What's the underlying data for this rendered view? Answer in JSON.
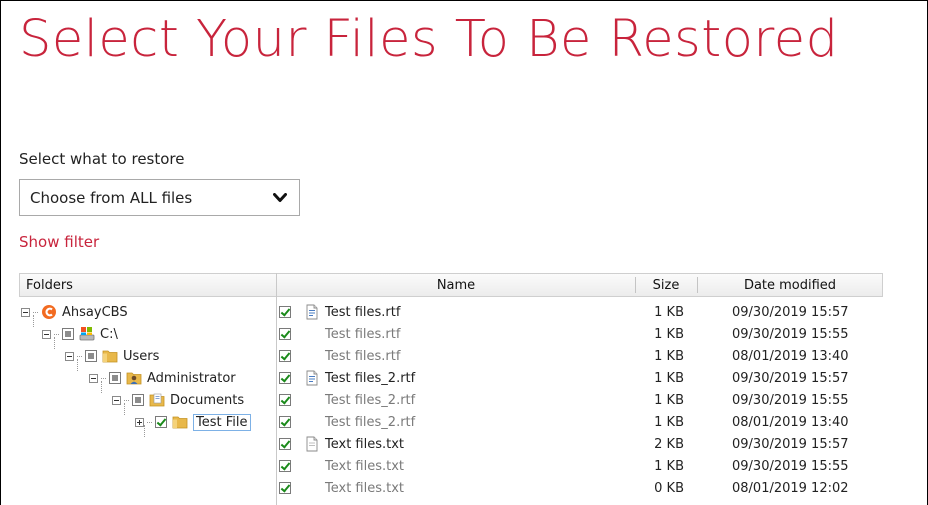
{
  "title": "Select Your Files To Be Restored",
  "restore_select": {
    "label": "Select what to restore",
    "value": "Choose from ALL files"
  },
  "show_filter": "Show filter",
  "folders": {
    "header": "Folders",
    "tree": [
      {
        "label": "AhsayCBS",
        "icon": "ahsay-logo-icon",
        "check": "none"
      },
      {
        "label": "C:\\",
        "icon": "drive-icon",
        "check": "partial"
      },
      {
        "label": "Users",
        "icon": "folder-icon",
        "check": "partial"
      },
      {
        "label": "Administrator",
        "icon": "user-folder-icon",
        "check": "partial"
      },
      {
        "label": "Documents",
        "icon": "documents-folder-icon",
        "check": "partial"
      },
      {
        "label": "Test File",
        "icon": "folder-icon",
        "check": "checked"
      }
    ]
  },
  "files": {
    "columns": {
      "name": "Name",
      "size": "Size",
      "date": "Date modified"
    },
    "rows": [
      {
        "name": "Test files.rtf",
        "size": "1 KB",
        "date": "09/30/2019 15:57",
        "latest": true,
        "icon": "rtf-file-icon"
      },
      {
        "name": "Test files.rtf",
        "size": "1 KB",
        "date": "09/30/2019 15:55",
        "latest": false
      },
      {
        "name": "Test files.rtf",
        "size": "1 KB",
        "date": "08/01/2019 13:40",
        "latest": false
      },
      {
        "name": "Test files_2.rtf",
        "size": "1 KB",
        "date": "09/30/2019 15:57",
        "latest": true,
        "icon": "rtf-file-icon"
      },
      {
        "name": "Test files_2.rtf",
        "size": "1 KB",
        "date": "09/30/2019 15:55",
        "latest": false
      },
      {
        "name": "Test files_2.rtf",
        "size": "1 KB",
        "date": "08/01/2019 13:40",
        "latest": false
      },
      {
        "name": "Text files.txt",
        "size": "2 KB",
        "date": "09/30/2019 15:57",
        "latest": true,
        "icon": "txt-file-icon"
      },
      {
        "name": "Text files.txt",
        "size": "1 KB",
        "date": "09/30/2019 15:55",
        "latest": false
      },
      {
        "name": "Text files.txt",
        "size": "0 KB",
        "date": "08/01/2019 12:02",
        "latest": false
      }
    ]
  },
  "colors": {
    "accent": "#c8243c",
    "check": "#1a8a1a"
  }
}
